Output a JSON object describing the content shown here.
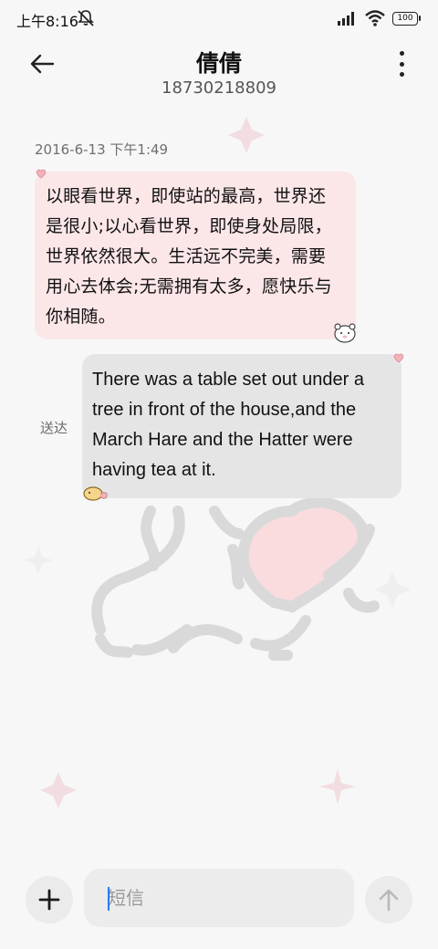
{
  "status_bar": {
    "time": "上午8:16",
    "battery": "100",
    "icons": [
      "mute-icon",
      "signal-icon",
      "wifi-icon",
      "battery-icon"
    ]
  },
  "header": {
    "contact_name": "倩倩",
    "phone_number": "18730218809",
    "back_icon": "back-arrow-icon",
    "menu_icon": "more-vertical-icon"
  },
  "conversation": {
    "timestamp": "2016-6-13 下午1:49",
    "messages": [
      {
        "direction": "received",
        "lines": [
          "以眼看世界，即使站的最高，世界还",
          "是很小;以心看世界，即使身处局限，",
          "世界依然很大。生活远不完美，需要",
          "用心去体会;无需拥有太多，愿快乐与",
          "你相随。"
        ]
      },
      {
        "direction": "sent",
        "lines": [
          "There was a table set out under a",
          "tree in front of the house,and the",
          "March Hare and the Hatter were",
          "having tea at it."
        ],
        "status": "送达"
      }
    ]
  },
  "composer": {
    "placeholder": "短信",
    "value": "",
    "add_icon": "plus-icon",
    "send_icon": "arrow-up-icon"
  },
  "colors": {
    "background": "#f7f7f7",
    "received_bubble": "#fbe6e8",
    "sent_bubble": "#e5e5e5",
    "accent_caret": "#2979ff"
  }
}
